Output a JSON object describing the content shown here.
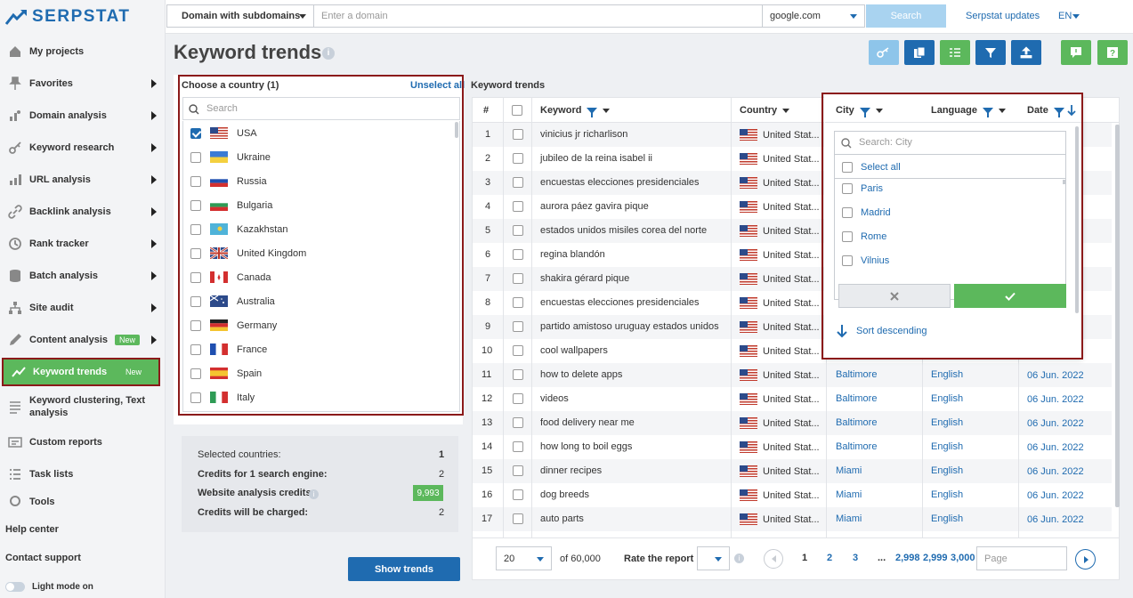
{
  "logo": {
    "text": "SERPSTAT"
  },
  "colors": {
    "brand": "#1f6bb0",
    "accent": "#5cb85c",
    "light": "#8ec5ea",
    "highlight": "#8b1a1a"
  },
  "topbar": {
    "scope": "Domain with subdomains",
    "domain_placeholder": "Enter a domain",
    "engine": "google.com",
    "search": "Search",
    "updates": "Serpstat updates",
    "lang": "EN"
  },
  "sidebar": {
    "items": [
      {
        "label": "My projects",
        "icon": "house-icon"
      },
      {
        "label": "Favorites",
        "icon": "pin-icon"
      },
      {
        "label": "Domain analysis",
        "icon": "chart-icon"
      },
      {
        "label": "Keyword research",
        "icon": "key-icon"
      },
      {
        "label": "URL analysis",
        "icon": "bars-icon"
      },
      {
        "label": "Backlink analysis",
        "icon": "link-icon"
      },
      {
        "label": "Rank tracker",
        "icon": "history-icon"
      },
      {
        "label": "Batch analysis",
        "icon": "database-icon"
      },
      {
        "label": "Site audit",
        "icon": "sitemap-icon"
      },
      {
        "label": "Content analysis",
        "icon": "pen-icon",
        "badge": "New"
      },
      {
        "label": "Keyword trends",
        "icon": "trend-icon",
        "badge": "New"
      },
      {
        "label": "Keyword clustering, Text analysis",
        "icon": "clustering-icon"
      },
      {
        "label": "Custom reports",
        "icon": "report-icon"
      },
      {
        "label": "Task lists",
        "icon": "list-icon"
      },
      {
        "label": "Tools",
        "icon": "tools-icon"
      }
    ],
    "help": "Help center",
    "support": "Contact support",
    "mode": "Light mode on"
  },
  "page": {
    "title": "Keyword trends"
  },
  "countries": {
    "header": "Choose a country (1)",
    "unselect": "Unselect all",
    "search_placeholder": "Search",
    "items": [
      {
        "name": "USA",
        "checked": true
      },
      {
        "name": "Ukraine"
      },
      {
        "name": "Russia"
      },
      {
        "name": "Bulgaria"
      },
      {
        "name": "Kazakhstan"
      },
      {
        "name": "United Kingdom"
      },
      {
        "name": "Canada"
      },
      {
        "name": "Australia"
      },
      {
        "name": "Germany"
      },
      {
        "name": "France"
      },
      {
        "name": "Spain"
      },
      {
        "name": "Italy"
      }
    ]
  },
  "summary": {
    "selected_label": "Selected countries:",
    "selected_val": "1",
    "credits_label": "Credits for 1 search engine:",
    "credits_val": "2",
    "website_label": "Website analysis credits:",
    "website_val": "9,993",
    "charged_label": "Credits will be charged:",
    "charged_val": "2",
    "button": "Show trends"
  },
  "table": {
    "title": "Keyword trends",
    "headers": {
      "num": "#",
      "keyword": "Keyword",
      "country": "Country",
      "city": "City",
      "language": "Language",
      "date": "Date"
    },
    "rows": [
      {
        "n": "1",
        "kw": "vinicius jr richarlison",
        "country": "United Stat..."
      },
      {
        "n": "2",
        "kw": "jubileo de la reina isabel ii",
        "country": "United Stat..."
      },
      {
        "n": "3",
        "kw": "encuestas elecciones presidenciales",
        "country": "United Stat..."
      },
      {
        "n": "4",
        "kw": "aurora páez gavira pique",
        "country": "United Stat..."
      },
      {
        "n": "5",
        "kw": "estados unidos misiles corea del norte",
        "country": "United Stat..."
      },
      {
        "n": "6",
        "kw": "regina blandón",
        "country": "United Stat..."
      },
      {
        "n": "7",
        "kw": "shakira gérard pique",
        "country": "United Stat..."
      },
      {
        "n": "8",
        "kw": "encuestas elecciones presidenciales",
        "country": "United Stat..."
      },
      {
        "n": "9",
        "kw": "partido amistoso uruguay estados unidos",
        "country": "United Stat..."
      },
      {
        "n": "10",
        "kw": "cool wallpapers",
        "country": "United Stat..."
      },
      {
        "n": "11",
        "kw": "how to delete apps",
        "country": "United Stat...",
        "city": "Baltimore",
        "lang": "English",
        "date": "06 Jun. 2022"
      },
      {
        "n": "12",
        "kw": "videos",
        "country": "United Stat...",
        "city": "Baltimore",
        "lang": "English",
        "date": "06 Jun. 2022"
      },
      {
        "n": "13",
        "kw": "food delivery near me",
        "country": "United Stat...",
        "city": "Baltimore",
        "lang": "English",
        "date": "06 Jun. 2022"
      },
      {
        "n": "14",
        "kw": "how long to boil eggs",
        "country": "United Stat...",
        "city": "Baltimore",
        "lang": "English",
        "date": "06 Jun. 2022"
      },
      {
        "n": "15",
        "kw": "dinner recipes",
        "country": "United Stat...",
        "city": "Miami",
        "lang": "English",
        "date": "06 Jun. 2022"
      },
      {
        "n": "16",
        "kw": "dog breeds",
        "country": "United Stat...",
        "city": "Miami",
        "lang": "English",
        "date": "06 Jun. 2022"
      },
      {
        "n": "17",
        "kw": "auto parts",
        "country": "United Stat...",
        "city": "Miami",
        "lang": "English",
        "date": "06 Jun. 2022"
      }
    ]
  },
  "city_filter": {
    "placeholder": "Search: City",
    "select_all": "Select all",
    "options": [
      "Paris",
      "Madrid",
      "Rome",
      "Vilnius"
    ],
    "sort": "Sort descending"
  },
  "pagination": {
    "per_page": "20",
    "total": "of 60,000",
    "rate": "Rate the report",
    "pages": [
      "1",
      "2",
      "3",
      "...",
      "2,998",
      "2,999",
      "3,000"
    ],
    "page_placeholder": "Page"
  }
}
